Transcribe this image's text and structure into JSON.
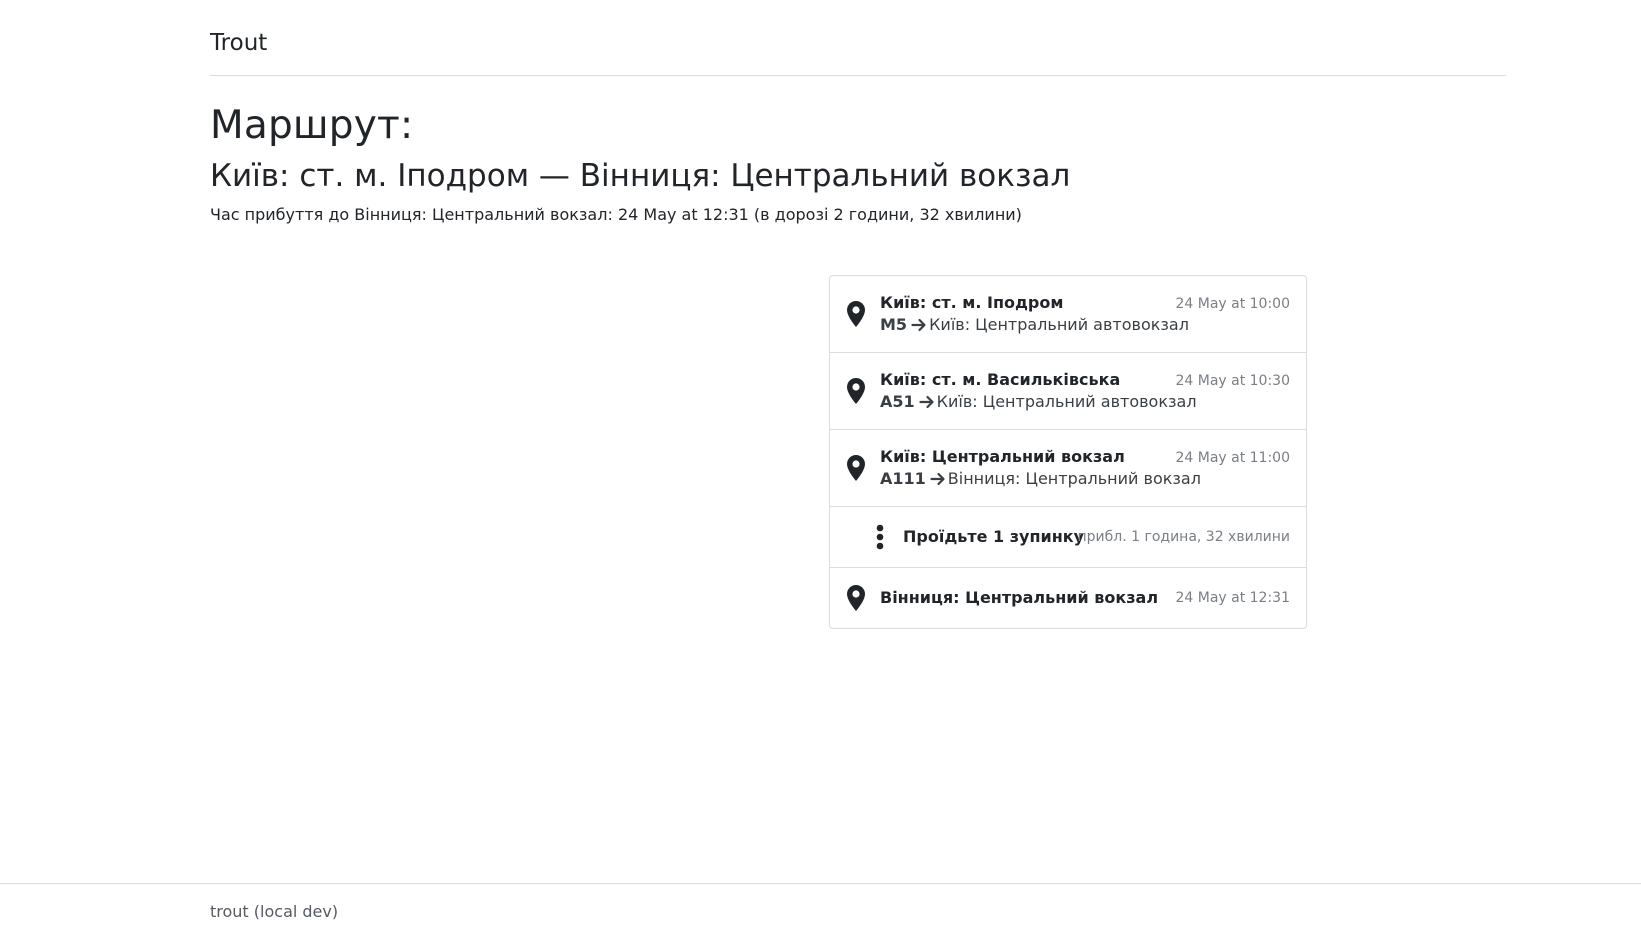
{
  "header": {
    "brand": "Trout"
  },
  "route": {
    "heading": "Маршрут:",
    "subheading": "Київ: ст. м. Іподром — Вінниця: Центральний вокзал",
    "arrival": "Час прибуття до Вінниця: Центральний вокзал: 24 May at 12:31 (в дорозі 2 години, 32 хвилини)"
  },
  "steps": [
    {
      "stop": "Київ: ст. м. Іподром",
      "code": "M5",
      "destination": "Київ: Центральний автовокзал",
      "time": "24 May at 10:00"
    },
    {
      "stop": "Київ: ст. м. Васильківська",
      "code": "A51",
      "destination": "Київ: Центральний автовокзал",
      "time": "24 May at 10:30"
    },
    {
      "stop": "Київ: Центральний вокзал",
      "code": "A111",
      "destination": "Вінниця: Центральний вокзал",
      "time": "24 May at 11:00"
    }
  ],
  "pass": {
    "text": "Проїдьте 1 зупинку",
    "duration": "прибл. 1 година, 32 хвилини"
  },
  "final_stop": {
    "stop": "Вінниця: Центральний вокзал",
    "time": "24 May at 12:31"
  },
  "footer": {
    "text": "trout (local dev)"
  },
  "icons": {
    "stop": "map-pin-icon",
    "direction": "arrow-right-icon",
    "pass": "vertical-dots-icon"
  },
  "colors": {
    "text": "#212529",
    "muted": "#7a7f85",
    "border": "#dcdcdc"
  }
}
